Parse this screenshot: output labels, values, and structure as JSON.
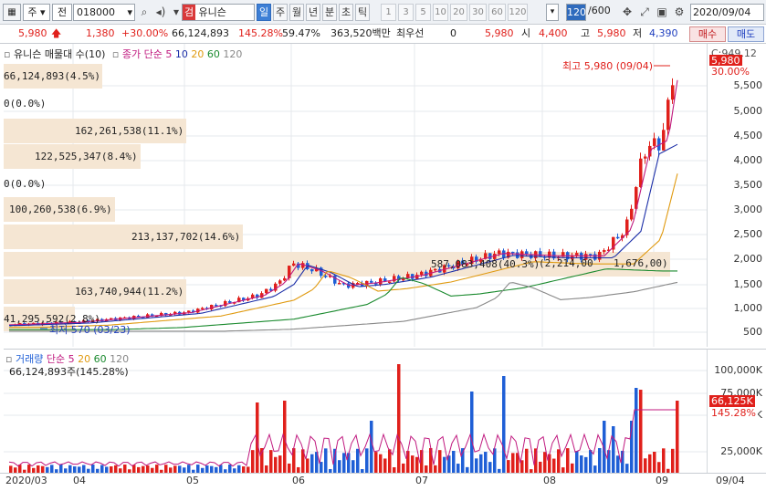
{
  "toolbar": {
    "market_select": "주",
    "prev_label": "전",
    "code": "018000",
    "name_icon_label": "검",
    "stock_name": "유니슨",
    "periods": [
      "일",
      "주",
      "월",
      "년",
      "분",
      "초",
      "틱"
    ],
    "active_period": "일",
    "intervals": [
      "1",
      "3",
      "5",
      "10",
      "20",
      "30",
      "60",
      "120"
    ],
    "count_value": "120",
    "count_total": "/600",
    "date": "2020/09/04"
  },
  "quote": {
    "price": "5,980",
    "change": "1,380",
    "change_pct": "+30.00%",
    "volume": "66,124,893",
    "vol_ratio": "145.28%",
    "turnover": "59.47%",
    "amount": "363,520백만",
    "best_label": "최우선",
    "best_value": "0",
    "last": "5,980",
    "open_label": "시",
    "open": "4,400",
    "high_label": "고",
    "high": "5,980",
    "low_label": "저",
    "low": "4,390",
    "buy_label": "매수",
    "sell_label": "매도"
  },
  "price_panel": {
    "legend_title": "유니슨 매물대 수(10)",
    "ma_label": "종가 단순",
    "ma_periods": [
      "5",
      "10",
      "20",
      "60",
      "120"
    ],
    "ma_colors": [
      "#c0197f",
      "#1c2fa8",
      "#e09a10",
      "#1a8a2e",
      "#888888"
    ],
    "high_marker": "최고 5,980 (09/04)",
    "low_marker": "최저 570 (03/23)",
    "right_badge_top": "C:949.12",
    "right_badge_price": "5,980",
    "right_badge_pct": "30.00%",
    "yaxis": [
      "5,500",
      "5,000",
      "4,500",
      "4,000",
      "3,500",
      "3,000",
      "2,500",
      "2,000",
      "1,500",
      "1,000",
      "500"
    ],
    "volume_profile": [
      {
        "label": "66,124,893(4.5%)"
      },
      {
        "label": "0(0.0%)"
      },
      {
        "label": "162,261,538(11.1%)"
      },
      {
        "label": "122,525,347(8.4%)"
      },
      {
        "label": "0(0.0%)"
      },
      {
        "label": "100,260,538(6.9%)"
      },
      {
        "label": "213,137,702(14.6%)"
      },
      {
        "label": "587,083,408(40.3%)"
      },
      {
        "label": "163,740,944(11.2%)"
      },
      {
        "label": "41,295,592(2.8%)"
      }
    ],
    "current_band_marker": "(2,214,00",
    "current_band_marker2": "1,676,00)"
  },
  "volume_panel": {
    "legend_title": "거래량",
    "ma_label": "단순",
    "ma_periods": [
      "5",
      "20",
      "60",
      "120"
    ],
    "summary": "66,124,893주(145.28%)",
    "yaxis": [
      "100,000K",
      "75,000K",
      "50,000K",
      "25,000K"
    ],
    "badge_value": "66,125K",
    "badge_pct": "145.28%"
  },
  "xaxis": [
    "2020/03",
    "04",
    "05",
    "06",
    "07",
    "08",
    "09",
    "09/04"
  ],
  "colors": {
    "up": "#e0201b",
    "down": "#1f5fd6",
    "band": "#f5e6d3",
    "accent": "#3d7fd6"
  },
  "chart_data": {
    "type": "candlestick",
    "x": [
      "2020/03",
      "04",
      "05",
      "06",
      "07",
      "08",
      "09"
    ],
    "price_close_approx": [
      650,
      740,
      930,
      1700,
      1600,
      2100,
      5980
    ],
    "ylim": [
      400,
      6000
    ],
    "high": 5980,
    "low": 570,
    "volume_ylim_k": [
      0,
      110000
    ]
  }
}
